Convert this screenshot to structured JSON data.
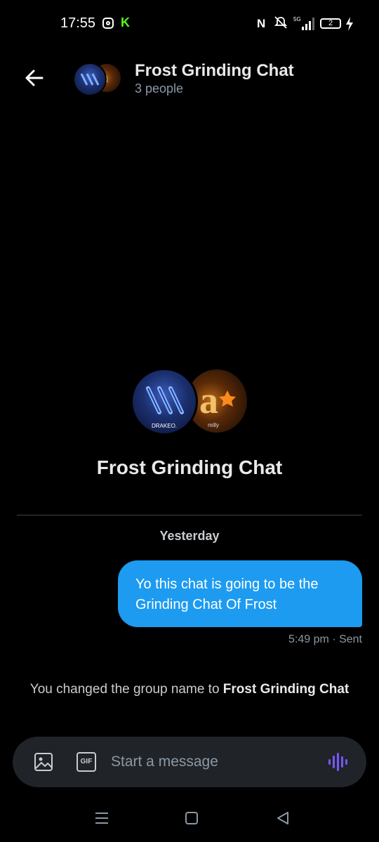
{
  "status_bar": {
    "time": "17:55",
    "battery_level": "2",
    "icons": [
      "instagram-icon",
      "kick-icon",
      "nfc-icon",
      "mute-icon",
      "5g-signal-icon",
      "battery-icon",
      "charging-icon"
    ],
    "network": "5G"
  },
  "header": {
    "title": "Frost Grinding Chat",
    "subtitle": "3 people"
  },
  "avatars": {
    "primary_label": "DRAKEO.",
    "secondary_label": "milly"
  },
  "group": {
    "title": "Frost Grinding Chat"
  },
  "conversation": {
    "date_label": "Yesterday",
    "message": {
      "text": "Yo this chat is going to be the Grinding Chat Of Frost",
      "meta": "5:49 pm · Sent"
    },
    "system": {
      "prefix": "You changed the group name to ",
      "name": "Frost Grinding Chat"
    }
  },
  "composer": {
    "placeholder": "Start a message",
    "gif_label": "GIF"
  },
  "colors": {
    "background": "#000000",
    "bubble": "#1d9bf0",
    "composer": "#202327",
    "voice_accent": "#7856ff"
  }
}
